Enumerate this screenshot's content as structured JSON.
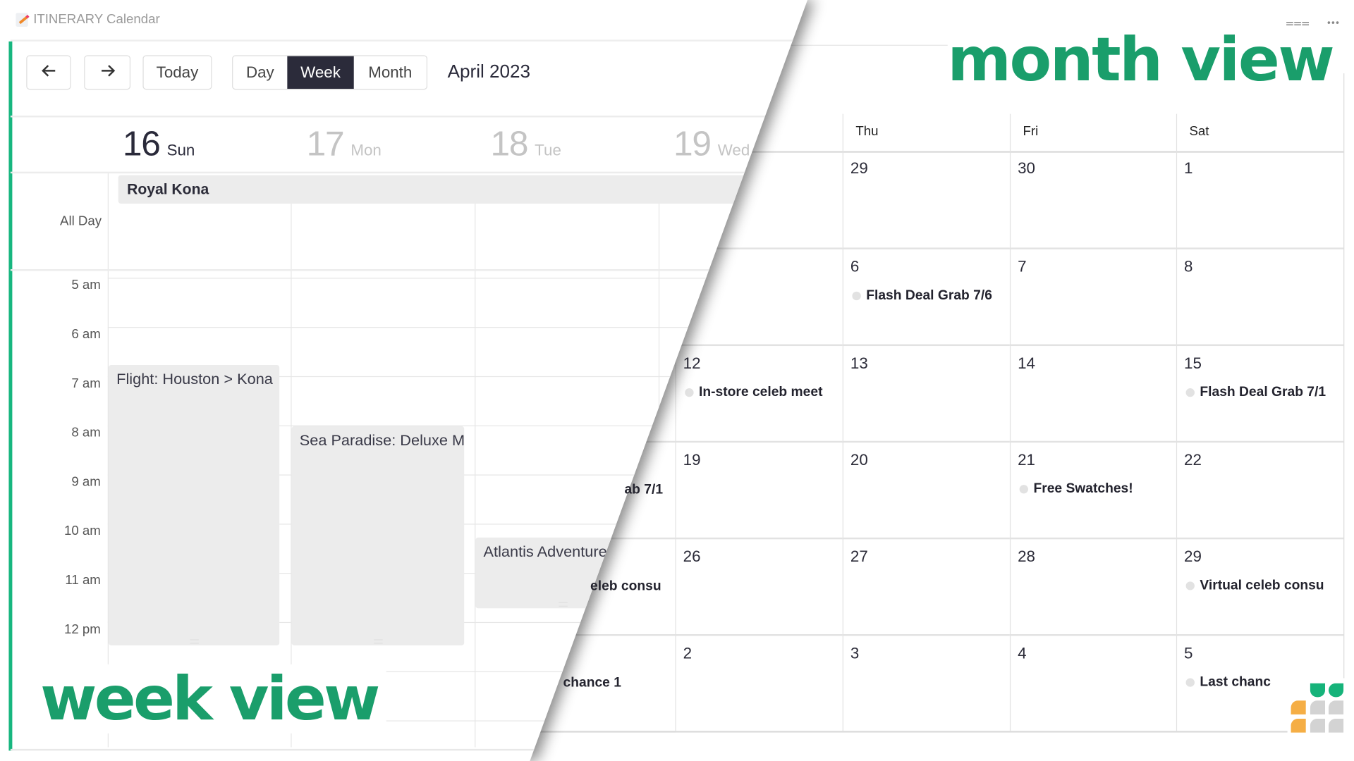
{
  "app": {
    "title": "ITINERARY Calendar"
  },
  "week_view": {
    "label": "week view",
    "toolbar": {
      "prev_icon": "arrow-left-icon",
      "next_icon": "arrow-right-icon",
      "prev_glyph": "🡐",
      "next_glyph": "🡒",
      "today": "Today",
      "views": [
        "Day",
        "Week",
        "Month"
      ],
      "active_view": "Week",
      "period": "April 2023"
    },
    "days": [
      {
        "num": "16",
        "name": "Sun",
        "today": true
      },
      {
        "num": "17",
        "name": "Mon",
        "today": false
      },
      {
        "num": "18",
        "name": "Tue",
        "today": false
      },
      {
        "num": "19",
        "name": "Wed",
        "today": false
      }
    ],
    "all_day_label": "All Day",
    "all_day_events": [
      {
        "title": "Royal Kona"
      }
    ],
    "hours": [
      "5 am",
      "6 am",
      "7 am",
      "8 am",
      "9 am",
      "10 am",
      "11 am",
      "12 pm"
    ],
    "events": [
      {
        "title": "Flight: Houston > Kona",
        "day": "Sun",
        "start": "7 am",
        "end": "12:30 pm"
      },
      {
        "title": "Sea Paradise: Deluxe Mo",
        "day": "Mon",
        "start": "8:15 am",
        "end": "12:30 pm"
      },
      {
        "title": "Atlantis Adventures",
        "day": "Tue",
        "start": "10:15 am",
        "end": "11:40 am"
      }
    ]
  },
  "month_view": {
    "label": "month view",
    "toolbar_icons": [
      "filter-icon",
      "more-icon"
    ],
    "filter_glyph": "⩶",
    "more_glyph": "•••",
    "weekdays": [
      "Thu",
      "Fri",
      "Sat"
    ],
    "weeks": [
      {
        "days": [
          {
            "n": ""
          },
          {
            "n": "29"
          },
          {
            "n": "30"
          },
          {
            "n": "1"
          }
        ]
      },
      {
        "days": [
          {
            "n": ""
          },
          {
            "n": "6",
            "event": "Flash Deal Grab 7/6"
          },
          {
            "n": "7"
          },
          {
            "n": "8"
          }
        ]
      },
      {
        "days": [
          {
            "n": "12",
            "event": "In-store celeb meet"
          },
          {
            "n": "13"
          },
          {
            "n": "14"
          },
          {
            "n": "15",
            "event": "Flash Deal Grab 7/1"
          }
        ]
      },
      {
        "days": [
          {
            "n": "19"
          },
          {
            "n": "20"
          },
          {
            "n": "21",
            "event": "Free Swatches!"
          },
          {
            "n": "22"
          }
        ]
      },
      {
        "days": [
          {
            "n": "26"
          },
          {
            "n": "27"
          },
          {
            "n": "28"
          },
          {
            "n": "29",
            "event": "Virtual celeb consu"
          }
        ]
      },
      {
        "days": [
          {
            "n": "2"
          },
          {
            "n": "3"
          },
          {
            "n": "4"
          },
          {
            "n": "5",
            "event": "Last chanc"
          }
        ]
      }
    ],
    "partial_events": [
      {
        "text": "ab 7/1",
        "row": 3
      },
      {
        "text": "eleb consu",
        "row": 4
      },
      {
        "text": "chance 1",
        "row": 5
      }
    ]
  },
  "colors": {
    "accent_green": "#1a9e6b",
    "sidebar_green": "#17b67f",
    "active_view_bg": "#2b2b3a",
    "event_bg": "#ececec"
  }
}
